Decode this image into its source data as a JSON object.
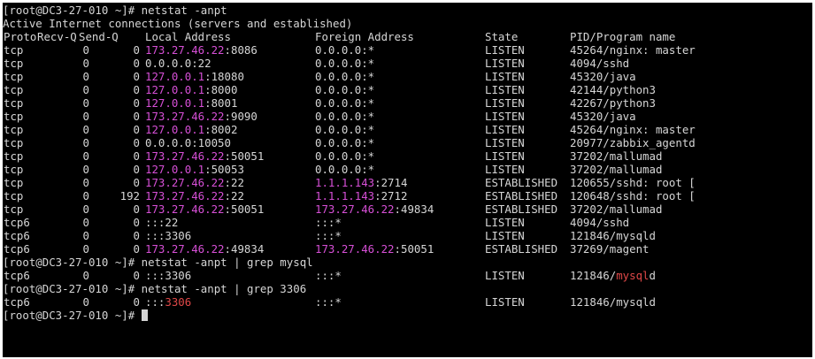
{
  "colors": {
    "background": "#000000",
    "text": "#d6d6d6",
    "ip_highlight": "#d64fd6",
    "grep_match": "#e04848"
  },
  "session1": {
    "prompt": "[root@DC3-27-010 ~]# netstat -anpt",
    "banner": "Active Internet connections (servers and established)",
    "headers": {
      "proto": "Proto",
      "recvq": "Recv-Q",
      "sendq": "Send-Q",
      "local": "Local Address",
      "foreign": "Foreign Address",
      "state": "State",
      "pid": "PID/Program name"
    },
    "rows": [
      {
        "proto": "tcp",
        "recvq": "0",
        "sendq": "0",
        "local_ip": "173.27.46.22",
        "local_port": ":8086",
        "foreign_ip": "",
        "foreign_port": "0.0.0.0:*",
        "state": "LISTEN",
        "pid": "45264/nginx: master"
      },
      {
        "proto": "tcp",
        "recvq": "0",
        "sendq": "0",
        "local_ip": "",
        "local_port": "0.0.0.0:22",
        "foreign_ip": "",
        "foreign_port": "0.0.0.0:*",
        "state": "LISTEN",
        "pid": "4094/sshd"
      },
      {
        "proto": "tcp",
        "recvq": "0",
        "sendq": "0",
        "local_ip": "127.0.0.1",
        "local_port": ":18080",
        "foreign_ip": "",
        "foreign_port": "0.0.0.0:*",
        "state": "LISTEN",
        "pid": "45320/java"
      },
      {
        "proto": "tcp",
        "recvq": "0",
        "sendq": "0",
        "local_ip": "127.0.0.1",
        "local_port": ":8000",
        "foreign_ip": "",
        "foreign_port": "0.0.0.0:*",
        "state": "LISTEN",
        "pid": "42144/python3"
      },
      {
        "proto": "tcp",
        "recvq": "0",
        "sendq": "0",
        "local_ip": "127.0.0.1",
        "local_port": ":8001",
        "foreign_ip": "",
        "foreign_port": "0.0.0.0:*",
        "state": "LISTEN",
        "pid": "42267/python3"
      },
      {
        "proto": "tcp",
        "recvq": "0",
        "sendq": "0",
        "local_ip": "173.27.46.22",
        "local_port": ":9090",
        "foreign_ip": "",
        "foreign_port": "0.0.0.0:*",
        "state": "LISTEN",
        "pid": "45320/java"
      },
      {
        "proto": "tcp",
        "recvq": "0",
        "sendq": "0",
        "local_ip": "127.0.0.1",
        "local_port": ":8002",
        "foreign_ip": "",
        "foreign_port": "0.0.0.0:*",
        "state": "LISTEN",
        "pid": "45264/nginx: master"
      },
      {
        "proto": "tcp",
        "recvq": "0",
        "sendq": "0",
        "local_ip": "",
        "local_port": "0.0.0.0:10050",
        "foreign_ip": "",
        "foreign_port": "0.0.0.0:*",
        "state": "LISTEN",
        "pid": "20977/zabbix_agentd"
      },
      {
        "proto": "tcp",
        "recvq": "0",
        "sendq": "0",
        "local_ip": "173.27.46.22",
        "local_port": ":50051",
        "foreign_ip": "",
        "foreign_port": "0.0.0.0:*",
        "state": "LISTEN",
        "pid": "37202/mallumad"
      },
      {
        "proto": "tcp",
        "recvq": "0",
        "sendq": "0",
        "local_ip": "127.0.0.1",
        "local_port": ":50053",
        "foreign_ip": "",
        "foreign_port": "0.0.0.0:*",
        "state": "LISTEN",
        "pid": "37202/mallumad"
      },
      {
        "proto": "tcp",
        "recvq": "0",
        "sendq": "0",
        "local_ip": "173.27.46.22",
        "local_port": ":22",
        "foreign_ip": "1.1.1.143",
        "foreign_port": ":2714",
        "state": "ESTABLISHED",
        "pid": "120655/sshd: root ["
      },
      {
        "proto": "tcp",
        "recvq": "0",
        "sendq": "192",
        "local_ip": "173.27.46.22",
        "local_port": ":22",
        "foreign_ip": "1.1.1.143",
        "foreign_port": ":2712",
        "state": "ESTABLISHED",
        "pid": "120648/sshd: root ["
      },
      {
        "proto": "tcp",
        "recvq": "0",
        "sendq": "0",
        "local_ip": "173.27.46.22",
        "local_port": ":50051",
        "foreign_ip": "173.27.46.22",
        "foreign_port": ":49834",
        "state": "ESTABLISHED",
        "pid": "37202/mallumad"
      },
      {
        "proto": "tcp6",
        "recvq": "0",
        "sendq": "0",
        "local_ip": "",
        "local_port": ":::22",
        "foreign_ip": "",
        "foreign_port": ":::*",
        "state": "LISTEN",
        "pid": "4094/sshd"
      },
      {
        "proto": "tcp6",
        "recvq": "0",
        "sendq": "0",
        "local_ip": "",
        "local_port": ":::3306",
        "foreign_ip": "",
        "foreign_port": ":::*",
        "state": "LISTEN",
        "pid": "121846/mysqld"
      },
      {
        "proto": "tcp6",
        "recvq": "0",
        "sendq": "0",
        "local_ip": "173.27.46.22",
        "local_port": ":49834",
        "foreign_ip": "173.27.46.22",
        "foreign_port": ":50051",
        "state": "ESTABLISHED",
        "pid": "37269/magent"
      }
    ]
  },
  "session2": {
    "prompt": "[root@DC3-27-010 ~]# netstat -anpt | grep mysql",
    "row": {
      "proto": "tcp6",
      "recvq": "0",
      "sendq": "0",
      "local": ":::3306",
      "foreign": ":::*",
      "state": "LISTEN",
      "pid_prefix": "121846/",
      "pid_match": "mysql",
      "pid_suffix": "d"
    }
  },
  "session3": {
    "prompt": "[root@DC3-27-010 ~]# netstat -anpt | grep 3306",
    "row": {
      "proto": "tcp6",
      "recvq": "0",
      "sendq": "0",
      "local_prefix": ":::",
      "local_match": "3306",
      "foreign": ":::*",
      "state": "LISTEN",
      "pid": "121846/mysqld"
    }
  },
  "final_prompt": "[root@DC3-27-010 ~]# "
}
